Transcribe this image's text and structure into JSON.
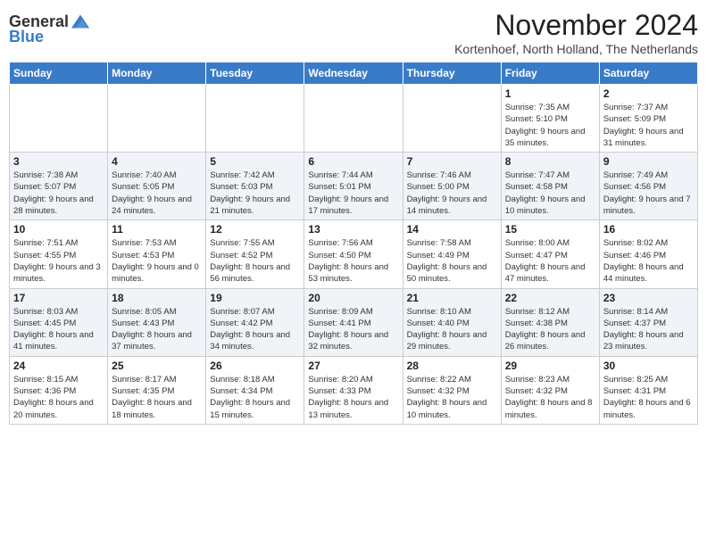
{
  "logo": {
    "general": "General",
    "blue": "Blue"
  },
  "title": "November 2024",
  "subtitle": "Kortenhoef, North Holland, The Netherlands",
  "weekdays": [
    "Sunday",
    "Monday",
    "Tuesday",
    "Wednesday",
    "Thursday",
    "Friday",
    "Saturday"
  ],
  "weeks": [
    [
      {
        "day": "",
        "info": ""
      },
      {
        "day": "",
        "info": ""
      },
      {
        "day": "",
        "info": ""
      },
      {
        "day": "",
        "info": ""
      },
      {
        "day": "",
        "info": ""
      },
      {
        "day": "1",
        "info": "Sunrise: 7:35 AM\nSunset: 5:10 PM\nDaylight: 9 hours and 35 minutes."
      },
      {
        "day": "2",
        "info": "Sunrise: 7:37 AM\nSunset: 5:09 PM\nDaylight: 9 hours and 31 minutes."
      }
    ],
    [
      {
        "day": "3",
        "info": "Sunrise: 7:38 AM\nSunset: 5:07 PM\nDaylight: 9 hours and 28 minutes."
      },
      {
        "day": "4",
        "info": "Sunrise: 7:40 AM\nSunset: 5:05 PM\nDaylight: 9 hours and 24 minutes."
      },
      {
        "day": "5",
        "info": "Sunrise: 7:42 AM\nSunset: 5:03 PM\nDaylight: 9 hours and 21 minutes."
      },
      {
        "day": "6",
        "info": "Sunrise: 7:44 AM\nSunset: 5:01 PM\nDaylight: 9 hours and 17 minutes."
      },
      {
        "day": "7",
        "info": "Sunrise: 7:46 AM\nSunset: 5:00 PM\nDaylight: 9 hours and 14 minutes."
      },
      {
        "day": "8",
        "info": "Sunrise: 7:47 AM\nSunset: 4:58 PM\nDaylight: 9 hours and 10 minutes."
      },
      {
        "day": "9",
        "info": "Sunrise: 7:49 AM\nSunset: 4:56 PM\nDaylight: 9 hours and 7 minutes."
      }
    ],
    [
      {
        "day": "10",
        "info": "Sunrise: 7:51 AM\nSunset: 4:55 PM\nDaylight: 9 hours and 3 minutes."
      },
      {
        "day": "11",
        "info": "Sunrise: 7:53 AM\nSunset: 4:53 PM\nDaylight: 9 hours and 0 minutes."
      },
      {
        "day": "12",
        "info": "Sunrise: 7:55 AM\nSunset: 4:52 PM\nDaylight: 8 hours and 56 minutes."
      },
      {
        "day": "13",
        "info": "Sunrise: 7:56 AM\nSunset: 4:50 PM\nDaylight: 8 hours and 53 minutes."
      },
      {
        "day": "14",
        "info": "Sunrise: 7:58 AM\nSunset: 4:49 PM\nDaylight: 8 hours and 50 minutes."
      },
      {
        "day": "15",
        "info": "Sunrise: 8:00 AM\nSunset: 4:47 PM\nDaylight: 8 hours and 47 minutes."
      },
      {
        "day": "16",
        "info": "Sunrise: 8:02 AM\nSunset: 4:46 PM\nDaylight: 8 hours and 44 minutes."
      }
    ],
    [
      {
        "day": "17",
        "info": "Sunrise: 8:03 AM\nSunset: 4:45 PM\nDaylight: 8 hours and 41 minutes."
      },
      {
        "day": "18",
        "info": "Sunrise: 8:05 AM\nSunset: 4:43 PM\nDaylight: 8 hours and 37 minutes."
      },
      {
        "day": "19",
        "info": "Sunrise: 8:07 AM\nSunset: 4:42 PM\nDaylight: 8 hours and 34 minutes."
      },
      {
        "day": "20",
        "info": "Sunrise: 8:09 AM\nSunset: 4:41 PM\nDaylight: 8 hours and 32 minutes."
      },
      {
        "day": "21",
        "info": "Sunrise: 8:10 AM\nSunset: 4:40 PM\nDaylight: 8 hours and 29 minutes."
      },
      {
        "day": "22",
        "info": "Sunrise: 8:12 AM\nSunset: 4:38 PM\nDaylight: 8 hours and 26 minutes."
      },
      {
        "day": "23",
        "info": "Sunrise: 8:14 AM\nSunset: 4:37 PM\nDaylight: 8 hours and 23 minutes."
      }
    ],
    [
      {
        "day": "24",
        "info": "Sunrise: 8:15 AM\nSunset: 4:36 PM\nDaylight: 8 hours and 20 minutes."
      },
      {
        "day": "25",
        "info": "Sunrise: 8:17 AM\nSunset: 4:35 PM\nDaylight: 8 hours and 18 minutes."
      },
      {
        "day": "26",
        "info": "Sunrise: 8:18 AM\nSunset: 4:34 PM\nDaylight: 8 hours and 15 minutes."
      },
      {
        "day": "27",
        "info": "Sunrise: 8:20 AM\nSunset: 4:33 PM\nDaylight: 8 hours and 13 minutes."
      },
      {
        "day": "28",
        "info": "Sunrise: 8:22 AM\nSunset: 4:32 PM\nDaylight: 8 hours and 10 minutes."
      },
      {
        "day": "29",
        "info": "Sunrise: 8:23 AM\nSunset: 4:32 PM\nDaylight: 8 hours and 8 minutes."
      },
      {
        "day": "30",
        "info": "Sunrise: 8:25 AM\nSunset: 4:31 PM\nDaylight: 8 hours and 6 minutes."
      }
    ]
  ]
}
